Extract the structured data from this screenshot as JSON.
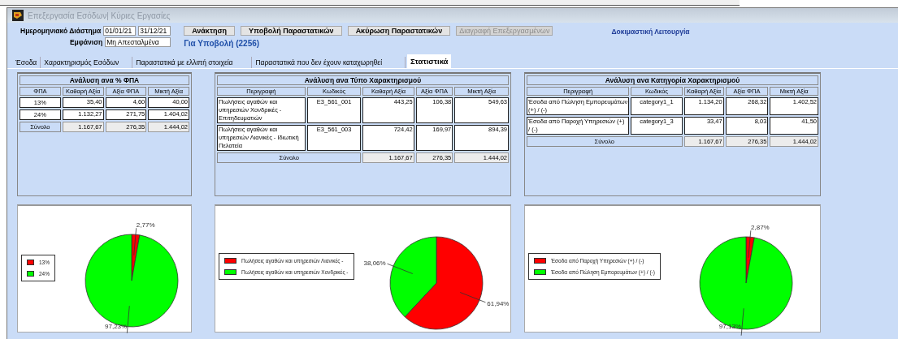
{
  "window": {
    "title": "Επεξεργασία Εσόδων| Κύριες Εργασίες"
  },
  "filters": {
    "date_range_label": "Ημερομηνιακό Διάστημα",
    "date_from": "01/01/21",
    "date_to": "31/12/21",
    "display_label": "Εμφάνιση",
    "display_value": "Μη Απεσταλμένα"
  },
  "buttons": [
    {
      "label": "Ανάκτηση",
      "disabled": false
    },
    {
      "label": "Υποβολή Παραστατικών",
      "disabled": false
    },
    {
      "label": "Ακύρωση Παραστατικών",
      "disabled": false
    },
    {
      "label": "Διαγραφή Επεξεργασμένων",
      "disabled": true
    }
  ],
  "submit_count": "Για Υποβολή (2256)",
  "mode_label": "Δοκιμαστική Λειτουργία",
  "tabs": [
    {
      "label": "Έσοδα",
      "selected": false
    },
    {
      "label": "Χαρακτηρισμός Εσόδων",
      "selected": false
    },
    {
      "label": "Παραστατικά με ελλιπή στοιχεία",
      "selected": false
    },
    {
      "label": "Παραστατικά που δεν έχουν καταχωρηθεί",
      "selected": false
    },
    {
      "label": "Στατιστικά",
      "selected": true
    }
  ],
  "tables": [
    {
      "title": "Ανάλυση ανα % ΦΠΑ",
      "columns": [
        "ΦΠΑ",
        "Καθαρή Αξία",
        "Αξία ΦΠΑ",
        "Μικτή Αξία"
      ],
      "rows": [
        [
          "13%",
          "35,40",
          "4,60",
          "40,00"
        ],
        [
          "24%",
          "1.132,27",
          "271,75",
          "1.404,02"
        ]
      ],
      "total_label": "Σύνολο",
      "total": [
        "1.167,67",
        "276,35",
        "1.444,02"
      ]
    },
    {
      "title": "Ανάλυση ανα Τύπο Χαρακτηρισμού",
      "columns": [
        "Περιγραφή",
        "Κωδικός",
        "Καθαρή Αξία",
        "Αξία ΦΠΑ",
        "Μικτή Αξία"
      ],
      "rows": [
        [
          "Πωλήσεις αγαθών και υπηρεσιών Χονδρικές - Επιτηδευματιών",
          "E3_561_001",
          "443,25",
          "106,38",
          "549,63"
        ],
        [
          "Πωλήσεις αγαθών και υπηρεσιών Λιανικές - Ιδιωτική Πελατεία",
          "E3_561_003",
          "724,42",
          "169,97",
          "894,39"
        ]
      ],
      "total_label": "Σύνολο",
      "total": [
        "1.167,67",
        "276,35",
        "1.444,02"
      ]
    },
    {
      "title": "Ανάλυση ανα Κατηγορία Χαρακτηρισμού",
      "columns": [
        "Περιγραφή",
        "Κωδικός",
        "Καθαρή Αξία",
        "Αξία ΦΠΑ",
        "Μικτή Αξία"
      ],
      "rows": [
        [
          "Έσοδα από Πώληση Εμπορευμάτων (+) / (-)",
          "category1_1",
          "1.134,20",
          "268,32",
          "1.402,52"
        ],
        [
          "Έσοδα από Παροχή Υπηρεσιών (+) / (-)",
          "category1_3",
          "33,47",
          "8,03",
          "41,50"
        ]
      ],
      "total_label": "Σύνολο",
      "total": [
        "1.167,67",
        "276,35",
        "1.444,02"
      ]
    }
  ],
  "charts": [
    {
      "chart_data": {
        "type": "pie",
        "categories": [
          "13%",
          "24%"
        ],
        "values": [
          2.77,
          97.23
        ],
        "value_labels": [
          "2,77%",
          "97,23%"
        ]
      }
    },
    {
      "chart_data": {
        "type": "pie",
        "categories": [
          "Πωλήσεις αγαθών και υπηρεσιών Λιανικές -",
          "Πωλήσεις αγαθών και υπηρεσιών Χονδρικές -"
        ],
        "values": [
          61.94,
          38.06
        ],
        "value_labels": [
          "61,94%",
          "38,06%"
        ]
      }
    },
    {
      "chart_data": {
        "type": "pie",
        "categories": [
          "Έσοδα από Παροχή Υπηρεσιών (+) / (-)",
          "Έσοδα από Πώληση Εμπορευμάτων (+) / (-)"
        ],
        "values": [
          2.87,
          97.13
        ],
        "value_labels": [
          "2,87%",
          "97,13%"
        ]
      }
    }
  ]
}
